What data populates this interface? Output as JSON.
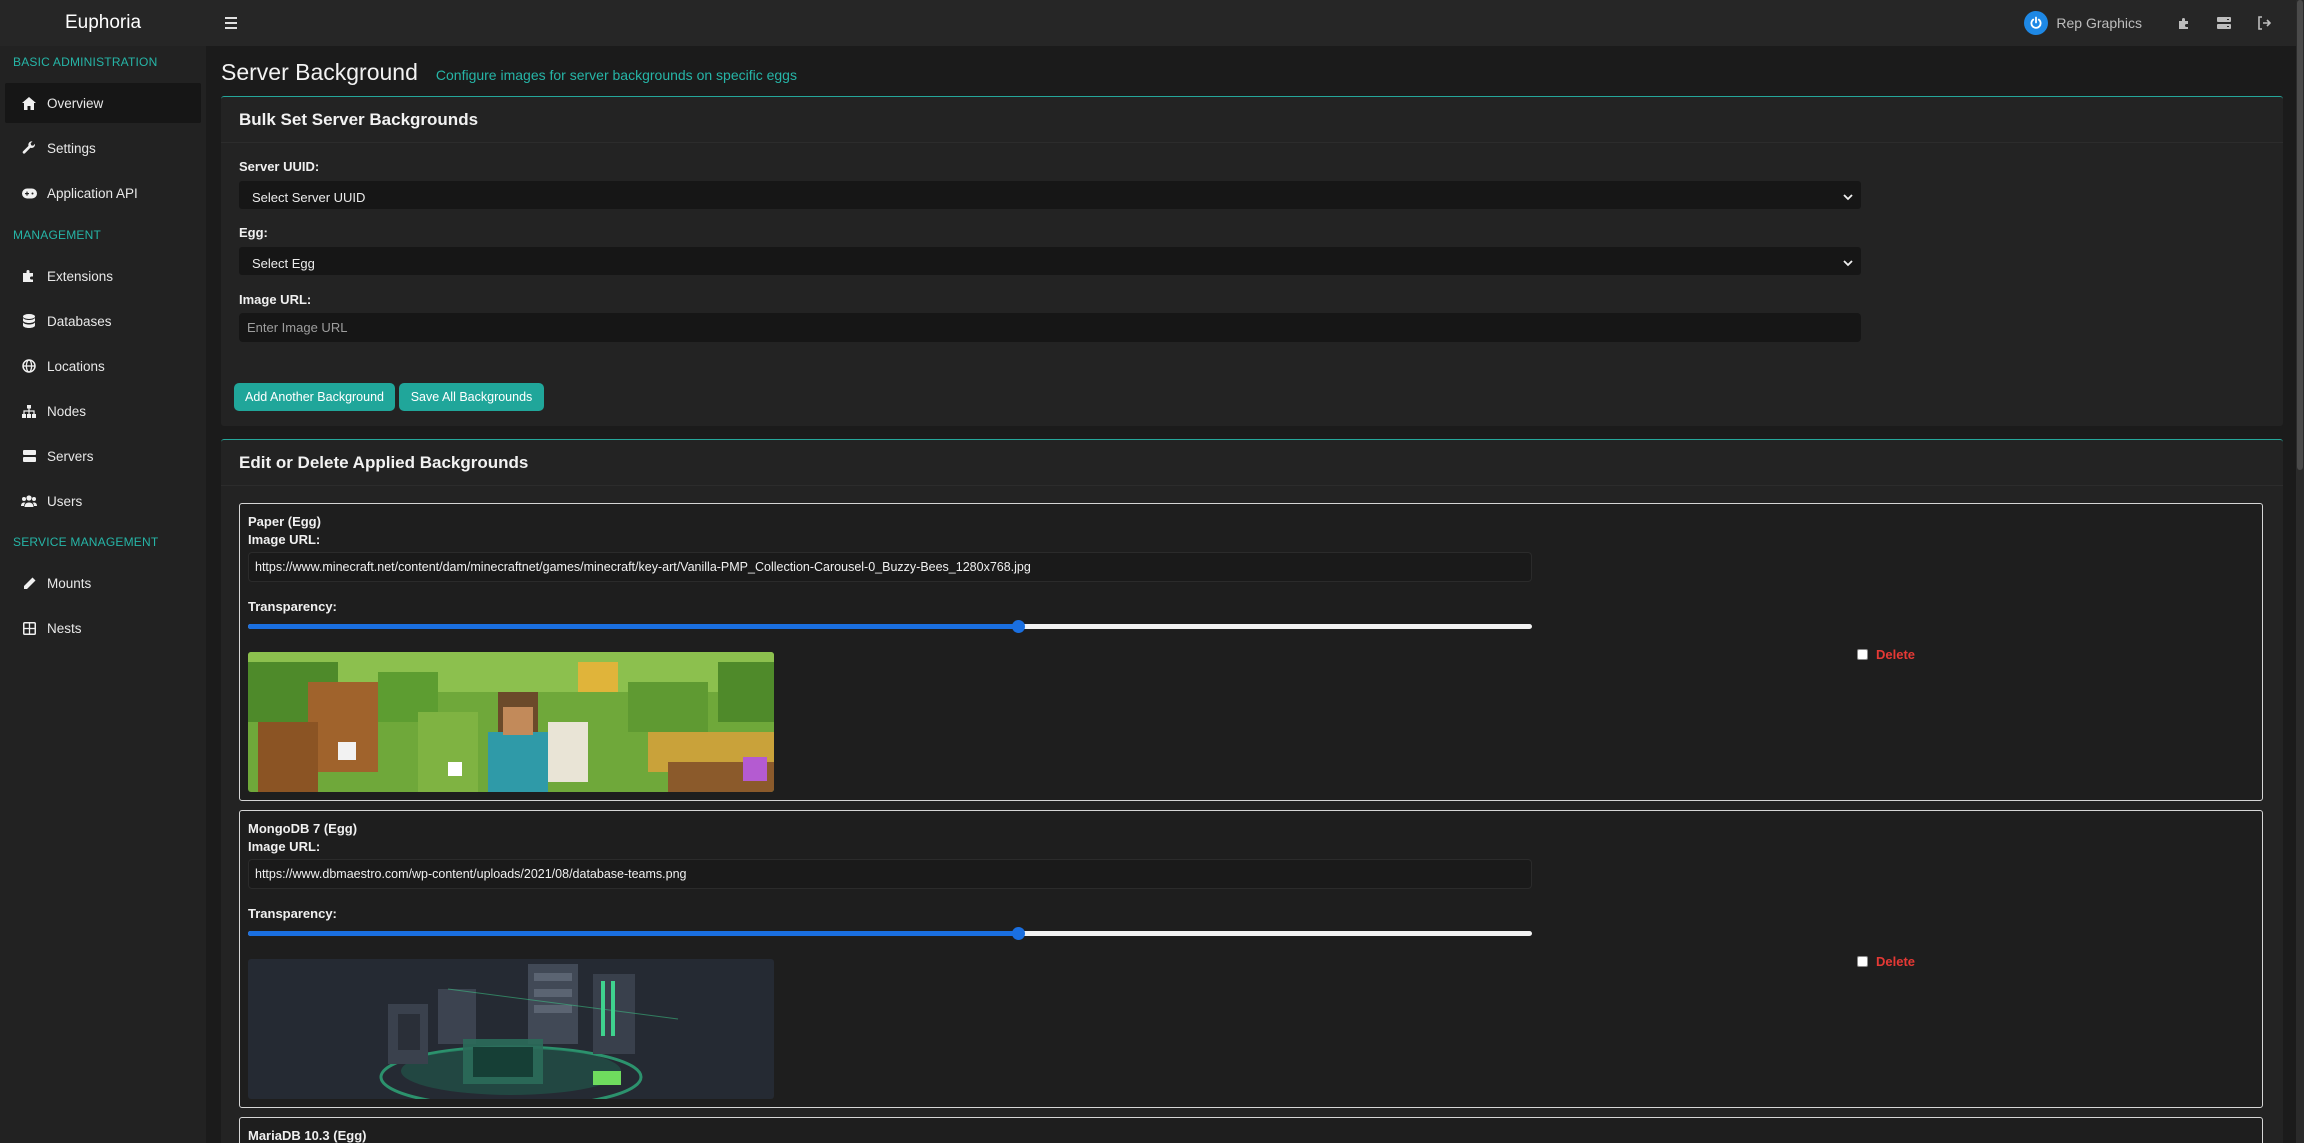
{
  "app": {
    "brand": "Euphoria"
  },
  "header": {
    "user_name": "Rep Graphics"
  },
  "sidebar": {
    "sections": [
      {
        "label": "BASIC ADMINISTRATION",
        "items": [
          "Overview",
          "Settings",
          "Application API"
        ]
      },
      {
        "label": "MANAGEMENT",
        "items": [
          "Extensions",
          "Databases",
          "Locations",
          "Nodes",
          "Servers",
          "Users"
        ]
      },
      {
        "label": "SERVICE MANAGEMENT",
        "items": [
          "Mounts",
          "Nests"
        ]
      }
    ]
  },
  "page": {
    "title": "Server Background",
    "subtitle": "Configure images for server backgrounds on specific eggs"
  },
  "bulk": {
    "heading": "Bulk Set Server Backgrounds",
    "server_uuid_label": "Server UUID:",
    "server_uuid_value": "Select Server UUID",
    "egg_label": "Egg:",
    "egg_value": "Select Egg",
    "image_url_label": "Image URL:",
    "image_url_placeholder": "Enter Image URL",
    "add_button": "Add Another Background",
    "save_button": "Save All Backgrounds"
  },
  "applied": {
    "heading": "Edit or Delete Applied Backgrounds",
    "image_url_label": "Image URL:",
    "transparency_label": "Transparency:",
    "delete_label": "Delete",
    "items": [
      {
        "name": "Paper (Egg)",
        "url": "https://www.minecraft.net/content/dam/minecraftnet/games/minecraft/key-art/Vanilla-PMP_Collection-Carousel-0_Buzzy-Bees_1280x768.jpg",
        "transparency": 0.6
      },
      {
        "name": "MongoDB 7 (Egg)",
        "url": "https://www.dbmaestro.com/wp-content/uploads/2021/08/database-teams.png",
        "transparency": 0.6
      },
      {
        "name": "MariaDB 10.3 (Egg)"
      }
    ]
  },
  "colors": {
    "accent": "#26b5a7",
    "button": "#20a69a",
    "slider": "#1a6fe0",
    "danger": "#e53935"
  }
}
